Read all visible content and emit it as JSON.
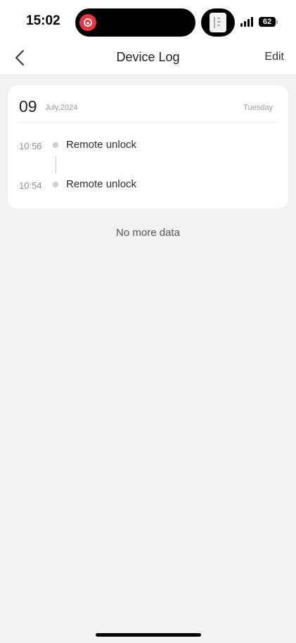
{
  "status_bar": {
    "time": "15:02",
    "battery": "62",
    "icons": [
      "netease-music-icon",
      "app-thumbnail-icon",
      "signal-icon",
      "battery-icon"
    ]
  },
  "nav": {
    "title": "Device Log",
    "edit_label": "Edit",
    "back_icon": "chevron-left-icon"
  },
  "log_day": {
    "day": "09",
    "month_year": "July,2024",
    "weekday": "Tuesday",
    "entries": [
      {
        "time": "10:56",
        "event": "Remote unlock"
      },
      {
        "time": "10:54",
        "event": "Remote unlock"
      }
    ]
  },
  "footer_text": "No more data",
  "colors": {
    "background": "#f0f1f3",
    "card": "#ffffff",
    "app_icon_red": "#e23a3f"
  }
}
